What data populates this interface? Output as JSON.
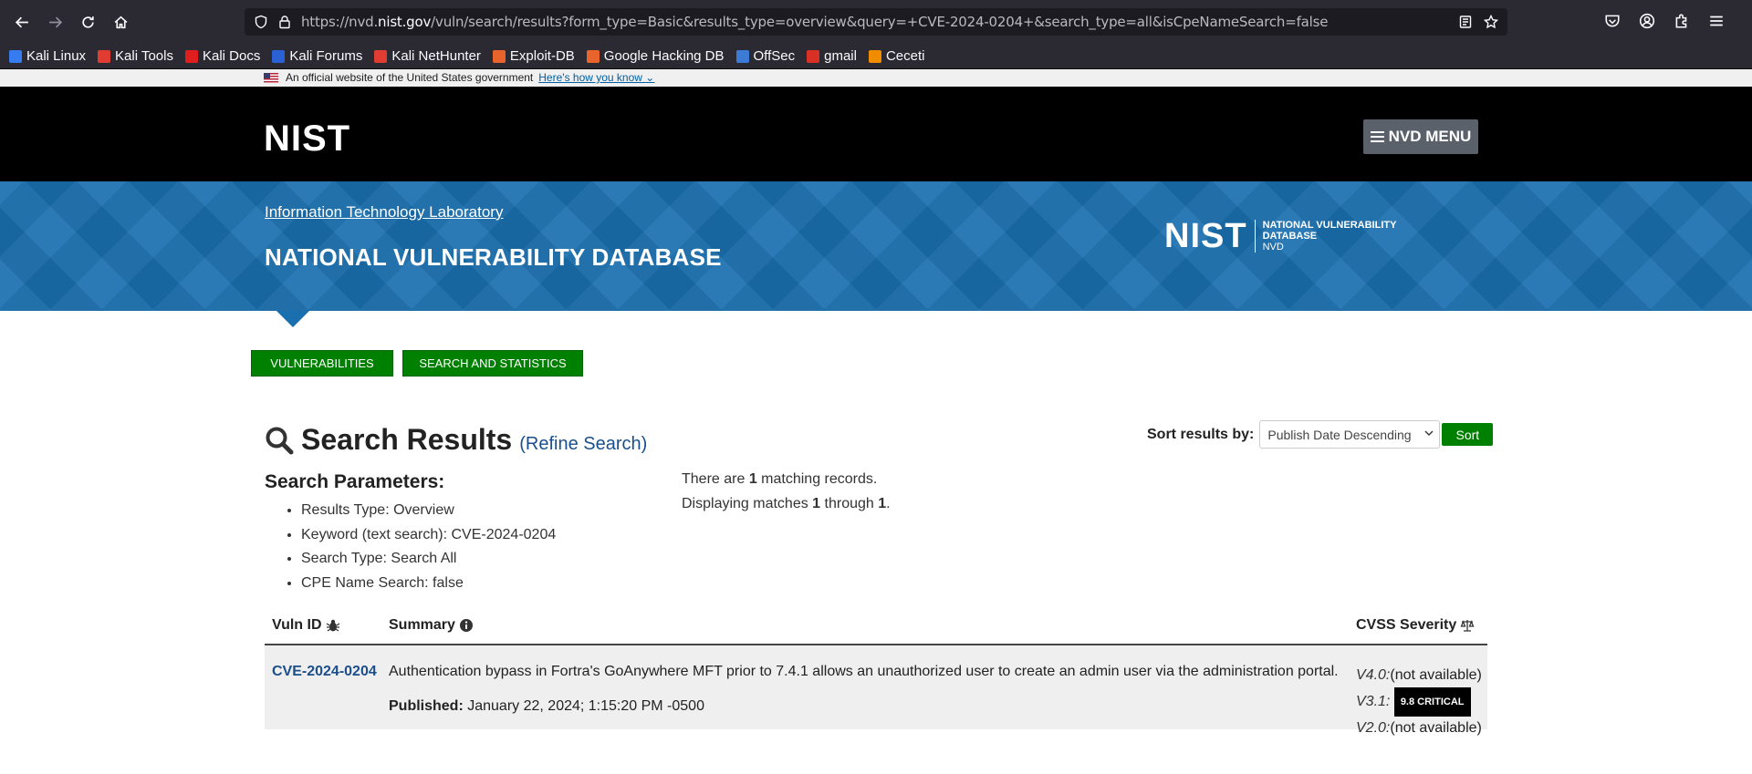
{
  "browser": {
    "url_prefix": "https://nvd.",
    "url_host": "nist.gov",
    "url_rest": "/vuln/search/results?form_type=Basic&results_type=overview&query=+CVE-2024-0204+&search_type=all&isCpeNameSearch=false",
    "bookmarks": [
      {
        "label": "Kali Linux",
        "color": "#367bf0"
      },
      {
        "label": "Kali Tools",
        "color": "#e03c31"
      },
      {
        "label": "Kali Docs",
        "color": "#e01e1e"
      },
      {
        "label": "Kali Forums",
        "color": "#2a62d6"
      },
      {
        "label": "Kali NetHunter",
        "color": "#e03c31"
      },
      {
        "label": "Exploit-DB",
        "color": "#e8642c"
      },
      {
        "label": "Google Hacking DB",
        "color": "#e8642c"
      },
      {
        "label": "OffSec",
        "color": "#3b7bd6"
      },
      {
        "label": "gmail",
        "color": "#d93025"
      },
      {
        "label": "Ceceti",
        "color": "#f08c00"
      }
    ]
  },
  "gov_banner": {
    "text": "An official website of the United States government",
    "link": "Here's how you know"
  },
  "header": {
    "logo": "NIST",
    "menu_label": "NVD MENU"
  },
  "banner": {
    "itl_link": "Information Technology Laboratory",
    "title": "NATIONAL VULNERABILITY DATABASE",
    "logo_mark": "NIST",
    "logo_line1": "NATIONAL VULNERABILITY",
    "logo_line2": "DATABASE",
    "logo_abbr": "NVD"
  },
  "nav": {
    "vulnerabilities": "VULNERABILITIES",
    "search_stats": "SEARCH AND STATISTICS"
  },
  "results": {
    "title": "Search Results",
    "refine": "(Refine Search)",
    "sort_label": "Sort results by:",
    "sort_value": "Publish Date Descending",
    "sort_button": "Sort",
    "params_heading": "Search Parameters:",
    "params": [
      "Results Type: Overview",
      "Keyword (text search): CVE-2024-0204",
      "Search Type: Search All",
      "CPE Name Search: false"
    ],
    "matches_pre": "There are ",
    "matches_count": "1",
    "matches_post": " matching records.",
    "display_pre": "Displaying matches ",
    "display_from": "1",
    "display_mid": " through ",
    "display_to": "1",
    "display_end": "."
  },
  "table": {
    "headers": {
      "vuln_id": "Vuln ID",
      "summary": "Summary",
      "severity": "CVSS Severity"
    },
    "rows": [
      {
        "id": "CVE-2024-0204",
        "summary": "Authentication bypass in Fortra's GoAnywhere MFT prior to 7.4.1 allows an unauthorized user to create an admin user via the administration portal.",
        "published_label": "Published:",
        "published": "January 22, 2024; 1:15:20 PM -0500",
        "v40_label": "V4.0:",
        "v40_value": "(not available)",
        "v31_label": "V3.1:",
        "v31_badge": "9.8 CRITICAL",
        "v20_label": "V2.0:",
        "v20_value": "(not available)"
      }
    ]
  }
}
